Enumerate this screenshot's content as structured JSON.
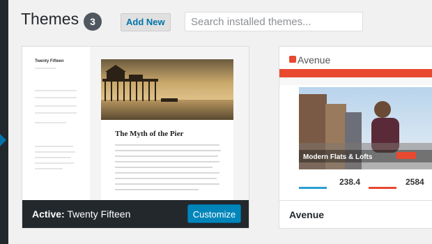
{
  "header": {
    "title": "Themes",
    "count": "3",
    "add_new_label": "Add New",
    "search_placeholder": "Search installed themes..."
  },
  "themes": [
    {
      "name": "Twenty Fifteen",
      "active_prefix": "Active:",
      "customize_label": "Customize",
      "preview": {
        "site_title": "Twenty Fifteen",
        "post_title": "The Myth of the Pier"
      }
    },
    {
      "name": "Avenue",
      "preview": {
        "logo": "Avenue",
        "hero_caption": "Modern Flats & Lofts",
        "stats": [
          "238.4",
          "2584"
        ]
      }
    }
  ],
  "colors": {
    "accent": "#0085ba",
    "admin_bar": "#23282d",
    "avenue_red": "#e8492f"
  }
}
